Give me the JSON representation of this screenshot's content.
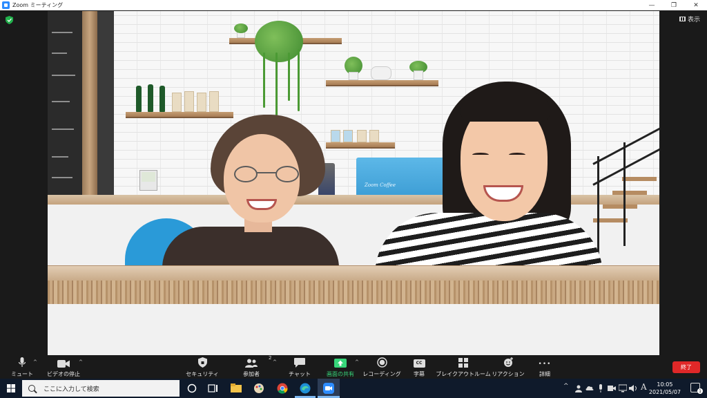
{
  "window": {
    "title": "Zoom ミーティング",
    "min_glyph": "—",
    "restore_glyph": "❐",
    "close_glyph": "✕"
  },
  "stage": {
    "view_label": "表示",
    "security_icon": "shield-check-icon"
  },
  "video": {
    "machine_brand": "Zoom Coffee"
  },
  "toolbar": {
    "items": [
      {
        "label": "ミュート",
        "icon": "microphone-icon"
      },
      {
        "label": "ビデオの停止",
        "icon": "video-camera-icon"
      },
      {
        "label": "セキュリティ",
        "icon": "shield-icon"
      },
      {
        "label": "参加者",
        "icon": "participants-icon",
        "count": "2"
      },
      {
        "label": "チャット",
        "icon": "chat-icon"
      },
      {
        "label": "画面の共有",
        "icon": "share-screen-icon"
      },
      {
        "label": "レコーディング",
        "icon": "record-icon"
      },
      {
        "label": "字幕",
        "icon": "cc-icon",
        "glyph": "CC"
      },
      {
        "label": "ブレイクアウトルーム",
        "icon": "breakout-rooms-icon"
      },
      {
        "label": "リアクション",
        "icon": "reaction-icon"
      },
      {
        "label": "詳細",
        "icon": "more-icon",
        "glyph": "•••"
      }
    ],
    "end_label": "終了",
    "caret": "^",
    "share_color": "#37d67a",
    "end_color": "#e02828"
  },
  "taskbar": {
    "search_placeholder": "ここに入力して検索",
    "time": "10:05",
    "date": "2021/05/07",
    "ime": "A",
    "tray_chevron": "^",
    "notification_count": "1"
  }
}
